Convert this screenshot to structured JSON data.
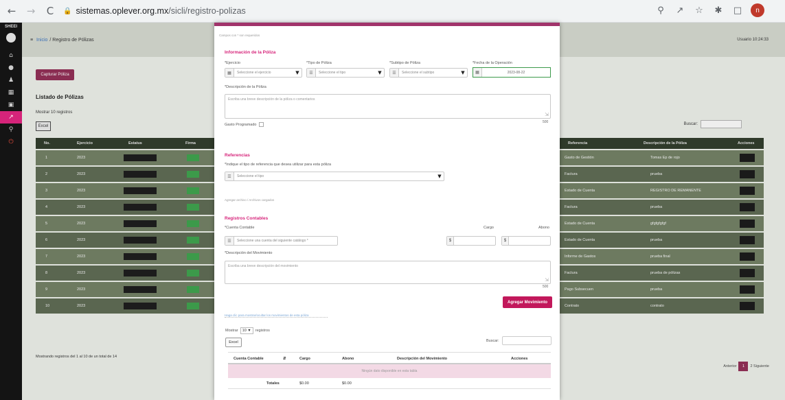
{
  "browser": {
    "url_host": "sistemas.oplever.org.mx",
    "url_path": "/sicli/registro-polizas",
    "back_icon": "←",
    "forward_icon": "→",
    "reload_icon": "C",
    "profile_initial": "n"
  },
  "app": {
    "rail_logo": "SHEEI",
    "breadcrumb_home": "Inicio",
    "breadcrumb_current": "Registro de Pólizas",
    "user_label": "Usuario 10:24:33",
    "new_button": "Capturar Póliza",
    "list_title": "Listado de Pólizas",
    "show_entries": "Mostrar 10 registros",
    "excel": "Excel",
    "search_label": "Buscar:",
    "columns": [
      "No.",
      "Ejercicio",
      "Estatus",
      "Firma",
      "Referencia",
      "Descripción de la Póliza",
      "Acciones"
    ],
    "rows": [
      {
        "no": "1",
        "year": "2023",
        "ref": "Gasto de Gestión",
        "desc": "Tomas Ep de rojo"
      },
      {
        "no": "2",
        "year": "2023",
        "ref": "Factura",
        "desc": "prueba"
      },
      {
        "no": "3",
        "year": "2023",
        "ref": "Estado de Cuenta",
        "desc": "REGISTRO DE REMANENTE"
      },
      {
        "no": "4",
        "year": "2023",
        "ref": "Factura",
        "desc": "prueba"
      },
      {
        "no": "5",
        "year": "2023",
        "ref": "Estado de Cuenta",
        "desc": "gfgfgfgfgf"
      },
      {
        "no": "6",
        "year": "2023",
        "ref": "Estado de Cuenta",
        "desc": "prueba"
      },
      {
        "no": "7",
        "year": "2023",
        "ref": "Informe de Gastos",
        "desc": "prueba final"
      },
      {
        "no": "8",
        "year": "2023",
        "ref": "Factura",
        "desc": "prueba de pólizas"
      },
      {
        "no": "9",
        "year": "2023",
        "ref": "Pago Subsecuen",
        "desc": "prueba"
      },
      {
        "no": "10",
        "year": "2023",
        "ref": "Contrato",
        "desc": "contrato"
      }
    ],
    "footer": "Mostrando registros del 1 al 10 de un total de 14",
    "pager": {
      "prev": "Anterior",
      "page": "1",
      "next": "2 Siguiente"
    }
  },
  "modal": {
    "caption": "Campos con * son requeridos",
    "poliza": {
      "title": "Información de la Póliza",
      "ejercicio_label": "*Ejercicio",
      "ejercicio_value": "Seleccione el ejercicio",
      "tipo_label": "*Tipo de Póliza",
      "tipo_value": "Seleccione el tipo",
      "subtipo_label": "*Subtipo de Póliza",
      "subtipo_value": "Seleccione el subtipo",
      "fecha_label": "*Fecha de la Operación",
      "fecha_value": "2023-08-22",
      "descripcion_label": "*Descripción de la Póliza",
      "descripcion_placeholder": "Escriba una breve descripción de la póliza o comentarios",
      "descripcion_counter": "500",
      "gasto_label": "Gasto Programado"
    },
    "referencias": {
      "title": "Referencias",
      "hint": "*Indique el tipo de referencia que desea utilizar para esta póliza",
      "select_value": "Seleccione el tipo",
      "note": "Agregar archivo / Archivos cargados"
    },
    "registros": {
      "title": "Registros Contables",
      "cuenta_label": "*Cuenta Contable",
      "cuenta_value": "Seleccione una cuenta del siguiente catálogo *",
      "cargo_label": "Cargo",
      "abono_label": "Abono",
      "currency": "$",
      "movimiento_label": "*Descripción del Movimiento",
      "movimiento_placeholder": "Escriba una breve descripción del movimiento",
      "movimiento_counter": "500",
      "add_button": "Agregar Movimiento",
      "help_link": "Haga clic para mostrar/ocultar los movimientos de esta póliza",
      "show_label": "Mostrar",
      "show_value": "10",
      "show_suffix": "registros",
      "excel": "Excel",
      "search_label": "Buscar:",
      "columns": [
        "Cuenta Contable",
        "Cargo",
        "Abono",
        "Descripción del Movimiento",
        "Acciones"
      ],
      "empty": "Ningún dato disponible en esta tabla",
      "totals_label": "Totales",
      "total_cargo": "$0.00",
      "total_abono": "$0.00"
    }
  },
  "colors": {
    "accent": "#d6247a",
    "button": "#c2185b",
    "date_border": "#3c9a4a"
  }
}
